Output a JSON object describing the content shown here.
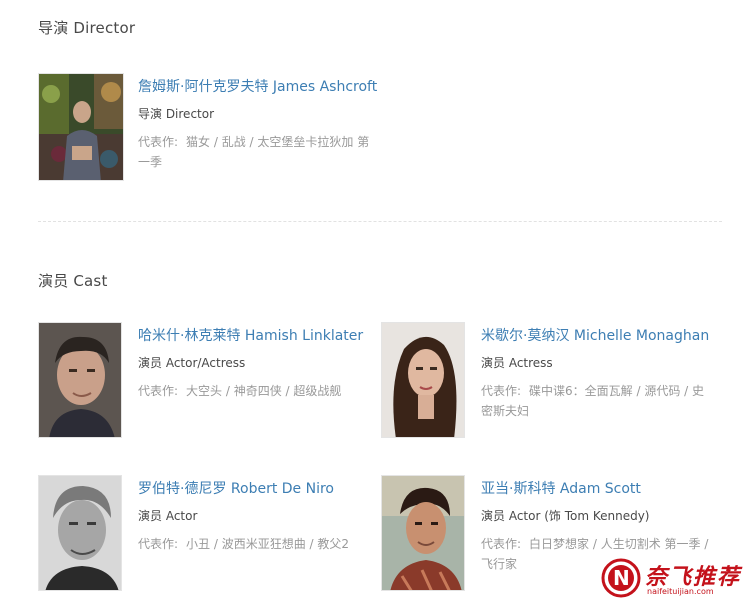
{
  "director_section": {
    "title": "导演 Director",
    "people": [
      {
        "name": "詹姆斯·阿什克罗夫特 James Ashcroft",
        "role": "导演 Director",
        "works_label": "代表作:",
        "works": "猫女 / 乱战 / 太空堡垒卡拉狄加 第一季"
      }
    ]
  },
  "cast_section": {
    "title": "演员 Cast",
    "people": [
      {
        "name": "哈米什·林克莱特 Hamish Linklater",
        "role": "演员 Actor/Actress",
        "works_label": "代表作:",
        "works": "大空头 / 神奇四侠 / 超级战舰"
      },
      {
        "name": "米歇尔·莫纳汉 Michelle Monaghan",
        "role": "演员 Actress",
        "works_label": "代表作:",
        "works": "碟中谍6：全面瓦解 / 源代码 / 史密斯夫妇"
      },
      {
        "name": "罗伯特·德尼罗 Robert De Niro",
        "role": "演员 Actor",
        "works_label": "代表作:",
        "works": "小丑 / 波西米亚狂想曲 / 教父2"
      },
      {
        "name": "亚当·斯科特 Adam Scott",
        "role": "演员 Actor (饰 Tom Kennedy)",
        "works_label": "代表作:",
        "works": "白日梦想家 / 人生切割术 第一季 / 飞行家"
      }
    ]
  },
  "watermark": {
    "logo_letter": "N",
    "name": "奈飞推荐",
    "url": "naifeituijian.com",
    "color": "#c4121b"
  }
}
